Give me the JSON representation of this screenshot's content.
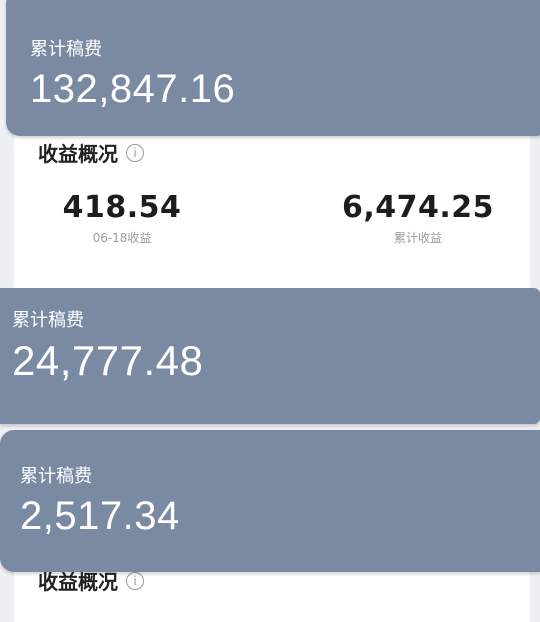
{
  "panels": [
    {
      "title": "累计稿费",
      "amount": "132,847.16"
    },
    {
      "title": "累计稿费",
      "amount": "24,777.48"
    },
    {
      "title": "累计稿费",
      "amount": "2,517.34"
    }
  ],
  "overview": {
    "title": "收益概况",
    "info_icon": "i",
    "left_stat": {
      "value": "418.54",
      "label": "06-18收益"
    },
    "right_stat": {
      "value": "6,474.25",
      "label": "累计收益"
    }
  },
  "overview_bottom": {
    "title": "收益概况",
    "info_icon": "i"
  },
  "colors": {
    "panel": "#7a8aa3",
    "card": "#ffffff"
  }
}
